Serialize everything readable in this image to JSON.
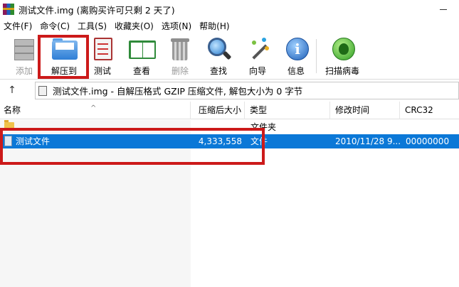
{
  "window": {
    "title": "测试文件.img (离购买许可只剩 2 天了)"
  },
  "menu": [
    "文件(F)",
    "命令(C)",
    "工具(S)",
    "收藏夹(O)",
    "选项(N)",
    "帮助(H)"
  ],
  "toolbar": {
    "add": "添加",
    "extract": "解压到",
    "test": "测试",
    "view": "查看",
    "delete": "删除",
    "find": "查找",
    "wizard": "向导",
    "info": "信息",
    "scan": "扫描病毒"
  },
  "address": {
    "path": "测试文件.img - 自解压格式 GZIP 压缩文件, 解包大小为 0 字节"
  },
  "columns": {
    "name": "名称",
    "packed": "压缩后大小",
    "type": "类型",
    "modified": "修改时间",
    "crc": "CRC32"
  },
  "rows": [
    {
      "name": "..",
      "packed": "",
      "type": "文件夹",
      "modified": "",
      "crc": ""
    },
    {
      "name": "测试文件",
      "packed": "4,333,558",
      "type": "文件",
      "modified": "2010/11/28 9...",
      "crc": "00000000"
    }
  ],
  "colors": {
    "selection": "#0b78d7",
    "annotation": "#cc1a1a"
  }
}
